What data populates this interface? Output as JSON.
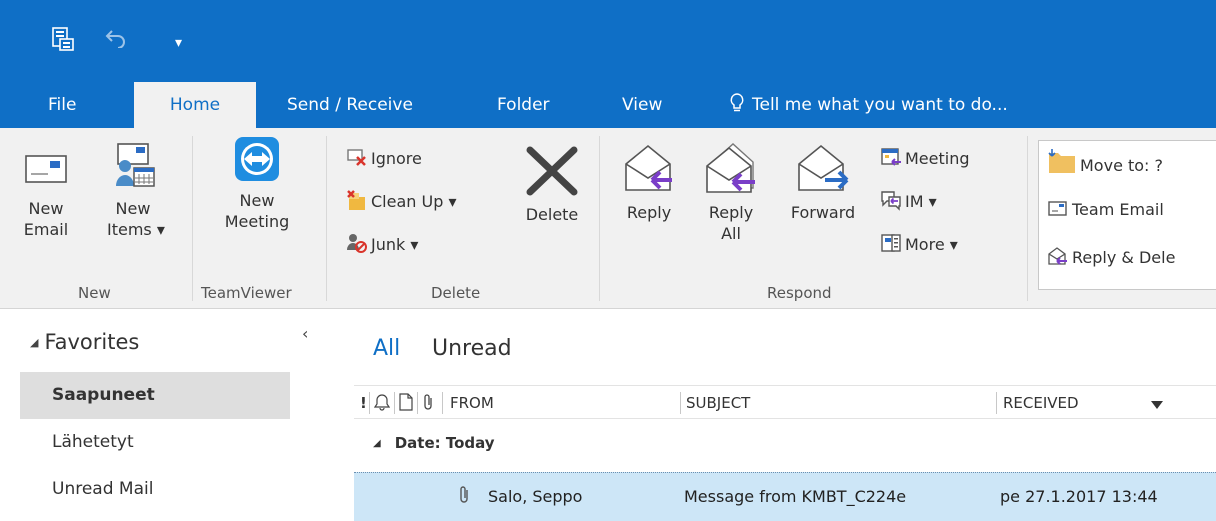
{
  "tabs": {
    "file": "File",
    "home": "Home",
    "send_receive": "Send / Receive",
    "folder": "Folder",
    "view": "View",
    "tell_me": "Tell me what you want to do..."
  },
  "ribbon": {
    "new": {
      "new_email": [
        "New",
        "Email"
      ],
      "new_items": [
        "New",
        "Items ▾"
      ],
      "group_label": "New"
    },
    "teamviewer": {
      "new_meeting": [
        "New",
        "Meeting"
      ],
      "group_label": "TeamViewer"
    },
    "delete": {
      "ignore": "Ignore",
      "clean_up": "Clean Up ▾",
      "junk": "Junk ▾",
      "delete": "Delete",
      "group_label": "Delete"
    },
    "respond": {
      "reply": "Reply",
      "reply_all": [
        "Reply",
        "All"
      ],
      "forward": "Forward",
      "meeting": "Meeting",
      "im": "IM ▾",
      "more": "More ▾",
      "group_label": "Respond"
    },
    "quick_steps": {
      "move_to": "Move to: ?",
      "team_email": "Team Email",
      "reply_delete": "Reply & Dele"
    }
  },
  "nav": {
    "favorites_title": "Favorites",
    "collapse_glyph": "‹",
    "items": [
      {
        "label": "Saapuneet",
        "selected": true
      },
      {
        "label": "Lähetetyt",
        "selected": false
      },
      {
        "label": "Unread Mail",
        "selected": false
      }
    ]
  },
  "list": {
    "filter_all": "All",
    "filter_unread": "Unread",
    "columns": {
      "importance": "!",
      "from": "FROM",
      "subject": "SUBJECT",
      "received": "RECEIVED"
    },
    "group_header": "Date: Today",
    "messages": [
      {
        "from": "Salo, Seppo",
        "subject": "Message from KMBT_C224e",
        "received": "pe 27.1.2017 13:44",
        "has_attachment": true
      }
    ]
  },
  "colors": {
    "accent": "#0f6fc6",
    "ribbon_bg": "#f1f1f1",
    "selected_row": "#cde6f7",
    "selected_nav": "#dedede"
  }
}
